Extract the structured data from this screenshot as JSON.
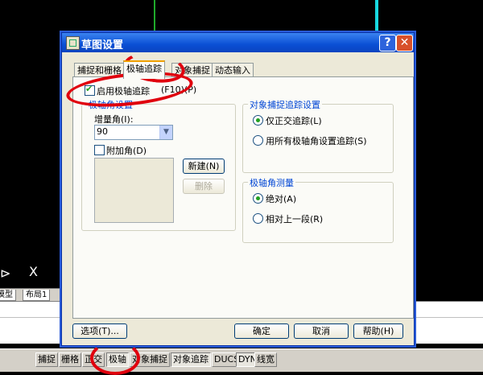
{
  "dialog": {
    "title": "草图设置",
    "help_btn": "?",
    "close_btn": "✕",
    "tabs": [
      "捕捉和栅格",
      "极轴追踪",
      "对象捕捉",
      "动态输入"
    ],
    "enable_polar_label": "启用极轴追踪",
    "enable_polar_shortcut": "(F10)(P)",
    "polar_angle_group": "极轴角设置",
    "increment_label": "增量角(I):",
    "increment_value": "90",
    "additional_angle_label": "附加角(D)",
    "new_btn": "新建(N)",
    "delete_btn": "删除",
    "snap_group": "对象捕捉追踪设置",
    "snap_ortho": "仅正交追踪(L)",
    "snap_all": "用所有极轴角设置追踪(S)",
    "measure_group": "极轴角测量",
    "measure_absolute": "绝对(A)",
    "measure_relative": "相对上一段(R)",
    "options_btn": "选项(T)...",
    "ok_btn": "确定",
    "cancel_btn": "取消",
    "help_text_btn": "帮助(H)"
  },
  "cad": {
    "ucs_arrow": "⊳",
    "ucs_x": "X",
    "model_tab": "模型",
    "layout1_tab": "布局1"
  },
  "statusbar": [
    "捕捉",
    "栅格",
    "正交",
    "极轴",
    "对象捕捉",
    "对象追踪",
    "DUCS",
    "DYN",
    "线宽"
  ],
  "colors": {
    "annotation": "#e0000d",
    "title_bar": "#0a4fd4",
    "group_label": "#0046d5"
  }
}
